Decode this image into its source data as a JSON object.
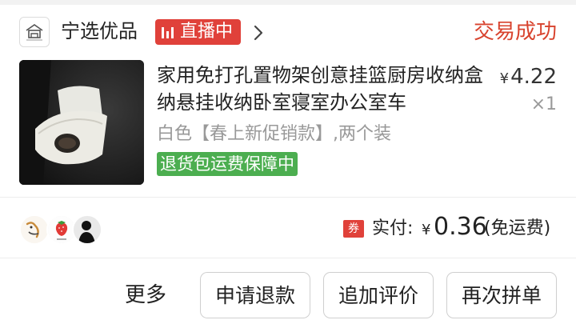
{
  "shop": {
    "name": "宁选优品",
    "logo_icon": "shop-logo-icon"
  },
  "live": {
    "label": "直播中",
    "icon": "live-bars-icon"
  },
  "order": {
    "status": "交易成功",
    "status_color": "#d8432e"
  },
  "product": {
    "title": "家用免打孔置物架创意挂篮厨房收纳盒纳悬挂收纳卧室寝室办公室车",
    "currency": "¥",
    "price": "4.22",
    "quantity": "×1",
    "spec": "白色【春上新促销款】,两个装",
    "guarantee": "退货包运费保障中",
    "guarantee_color": "#4cae50"
  },
  "participants": {
    "avatar_icons": [
      "cartoon-avatar",
      "strawberry-avatar",
      "silhouette-avatar"
    ]
  },
  "payment": {
    "coupon_label": "券",
    "label": "实付:",
    "currency": "¥",
    "amount": "0.36",
    "note": "(免运费)"
  },
  "actions": {
    "more": "更多",
    "refund": "申请退款",
    "review": "追加评价",
    "rebuy": "再次拼单"
  },
  "colors": {
    "accent": "#e0413a"
  }
}
